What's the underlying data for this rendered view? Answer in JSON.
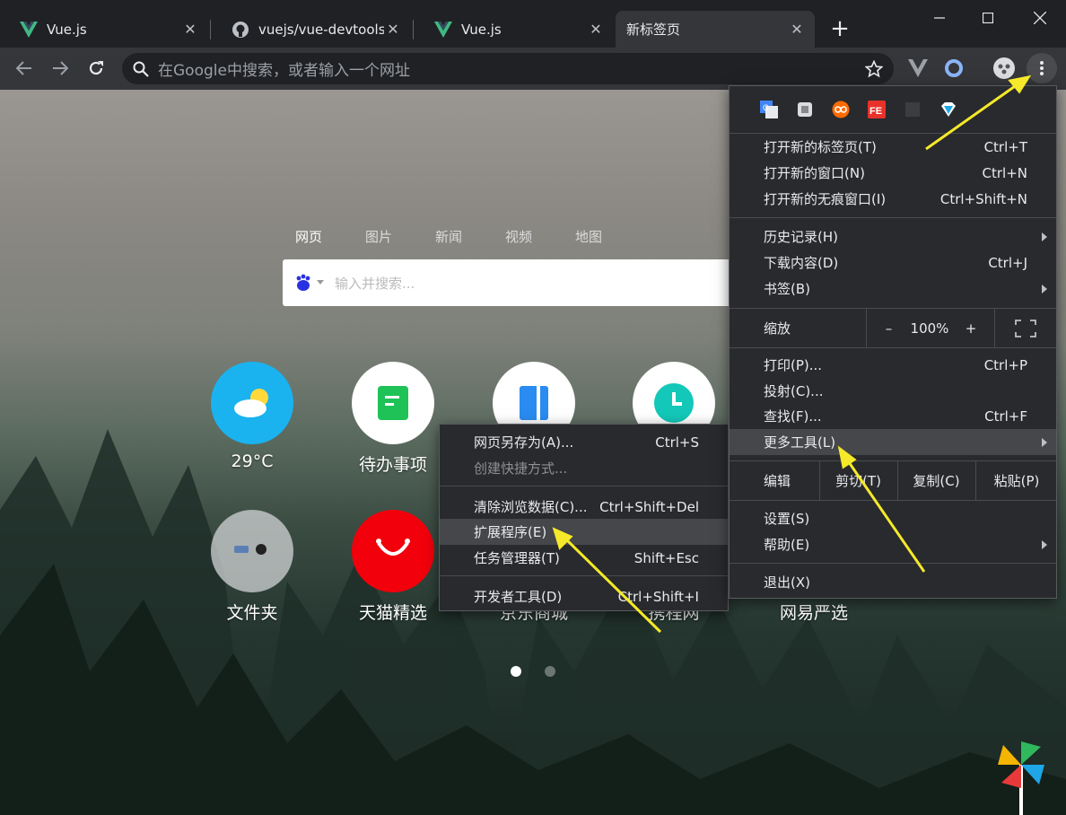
{
  "tabs": [
    {
      "title": "Vue.js",
      "icon": "vue-logo-icon"
    },
    {
      "title": "vuejs/vue-devtools:",
      "icon": "github-icon"
    },
    {
      "title": "Vue.js",
      "icon": "vue-logo-icon"
    },
    {
      "title": "新标签页",
      "icon": ""
    }
  ],
  "tab_close": "✕",
  "new_tab_label": "+",
  "omnibox": {
    "placeholder": "在Google中搜索，或者输入一个网址"
  },
  "page": {
    "search_tabs": [
      "网页",
      "图片",
      "新闻",
      "视频",
      "地图"
    ],
    "search_placeholder": "输入并搜索...",
    "tiles": [
      {
        "label": "29°C",
        "icon": "weather-icon"
      },
      {
        "label": "待办事项",
        "icon": "todo-icon"
      },
      {
        "label": "",
        "icon": "book-icon"
      },
      {
        "label": "",
        "icon": "clock-icon"
      },
      {
        "label": "文件夹",
        "icon": "folder-icon"
      },
      {
        "label": "天猫精选",
        "icon": "tmall-icon"
      },
      {
        "label": "京东商城",
        "icon": "jd-icon"
      },
      {
        "label": "携程网",
        "icon": "ctrip-icon"
      },
      {
        "label": "网易严选",
        "icon": "netease-icon"
      }
    ],
    "pager": {
      "pages": 2,
      "current": 1
    }
  },
  "chrome_menu": {
    "new_tab": {
      "label": "打开新的标签页(T)",
      "key": "Ctrl+T"
    },
    "new_window": {
      "label": "打开新的窗口(N)",
      "key": "Ctrl+N"
    },
    "incognito": {
      "label": "打开新的无痕窗口(I)",
      "key": "Ctrl+Shift+N"
    },
    "history": {
      "label": "历史记录(H)"
    },
    "downloads": {
      "label": "下载内容(D)",
      "key": "Ctrl+J"
    },
    "bookmarks": {
      "label": "书签(B)"
    },
    "zoom": {
      "label": "缩放",
      "minus": "–",
      "value": "100%",
      "plus": "+"
    },
    "print": {
      "label": "打印(P)...",
      "key": "Ctrl+P"
    },
    "cast": {
      "label": "投射(C)..."
    },
    "find": {
      "label": "查找(F)...",
      "key": "Ctrl+F"
    },
    "more_tools": {
      "label": "更多工具(L)"
    },
    "edit": {
      "label": "编辑",
      "cut": "剪切(T)",
      "copy": "复制(C)",
      "paste": "粘贴(P)"
    },
    "settings": {
      "label": "设置(S)"
    },
    "help": {
      "label": "帮助(E)"
    },
    "exit": {
      "label": "退出(X)"
    }
  },
  "more_tools_menu": {
    "save_page": {
      "label": "网页另存为(A)...",
      "key": "Ctrl+S"
    },
    "create_shortcut": {
      "label": "创建快捷方式..."
    },
    "clear_data": {
      "label": "清除浏览数据(C)...",
      "key": "Ctrl+Shift+Del"
    },
    "extensions": {
      "label": "扩展程序(E)"
    },
    "task_manager": {
      "label": "任务管理器(T)",
      "key": "Shift+Esc"
    },
    "devtools": {
      "label": "开发者工具(D)",
      "key": "Ctrl+Shift+I"
    }
  },
  "colors": {
    "annotation_arrow": "#f5e92a",
    "vue_green": "#41b883",
    "menu_bg": "#292a2d",
    "highlight": "#46474a"
  }
}
